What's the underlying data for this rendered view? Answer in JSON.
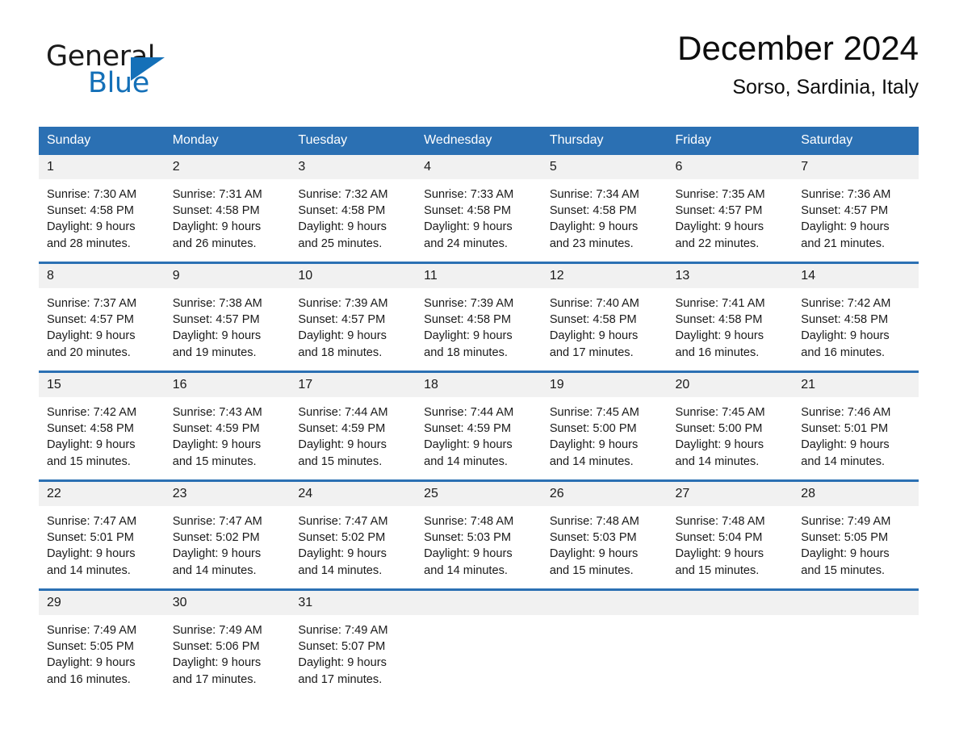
{
  "branding": {
    "logo_primary": "General",
    "logo_secondary": "Blue",
    "logo_triangle_color": "#1470b8"
  },
  "header": {
    "title": "December 2024",
    "subtitle": "Sorso, Sardinia, Italy"
  },
  "colors": {
    "header_blue": "#2b70b3",
    "row_divider_blue": "#2b70b3",
    "daynum_band": "#f1f1f1",
    "text": "#1a1a1a"
  },
  "weekday_headers": [
    "Sunday",
    "Monday",
    "Tuesday",
    "Wednesday",
    "Thursday",
    "Friday",
    "Saturday"
  ],
  "labels": {
    "sunrise_prefix": "Sunrise:",
    "sunset_prefix": "Sunset:",
    "daylight_prefix": "Daylight:"
  },
  "weeks": [
    [
      {
        "day": "1",
        "sunrise": "Sunrise: 7:30 AM",
        "sunset": "Sunset: 4:58 PM",
        "daylight_line1": "Daylight: 9 hours",
        "daylight_line2": "and 28 minutes."
      },
      {
        "day": "2",
        "sunrise": "Sunrise: 7:31 AM",
        "sunset": "Sunset: 4:58 PM",
        "daylight_line1": "Daylight: 9 hours",
        "daylight_line2": "and 26 minutes."
      },
      {
        "day": "3",
        "sunrise": "Sunrise: 7:32 AM",
        "sunset": "Sunset: 4:58 PM",
        "daylight_line1": "Daylight: 9 hours",
        "daylight_line2": "and 25 minutes."
      },
      {
        "day": "4",
        "sunrise": "Sunrise: 7:33 AM",
        "sunset": "Sunset: 4:58 PM",
        "daylight_line1": "Daylight: 9 hours",
        "daylight_line2": "and 24 minutes."
      },
      {
        "day": "5",
        "sunrise": "Sunrise: 7:34 AM",
        "sunset": "Sunset: 4:58 PM",
        "daylight_line1": "Daylight: 9 hours",
        "daylight_line2": "and 23 minutes."
      },
      {
        "day": "6",
        "sunrise": "Sunrise: 7:35 AM",
        "sunset": "Sunset: 4:57 PM",
        "daylight_line1": "Daylight: 9 hours",
        "daylight_line2": "and 22 minutes."
      },
      {
        "day": "7",
        "sunrise": "Sunrise: 7:36 AM",
        "sunset": "Sunset: 4:57 PM",
        "daylight_line1": "Daylight: 9 hours",
        "daylight_line2": "and 21 minutes."
      }
    ],
    [
      {
        "day": "8",
        "sunrise": "Sunrise: 7:37 AM",
        "sunset": "Sunset: 4:57 PM",
        "daylight_line1": "Daylight: 9 hours",
        "daylight_line2": "and 20 minutes."
      },
      {
        "day": "9",
        "sunrise": "Sunrise: 7:38 AM",
        "sunset": "Sunset: 4:57 PM",
        "daylight_line1": "Daylight: 9 hours",
        "daylight_line2": "and 19 minutes."
      },
      {
        "day": "10",
        "sunrise": "Sunrise: 7:39 AM",
        "sunset": "Sunset: 4:57 PM",
        "daylight_line1": "Daylight: 9 hours",
        "daylight_line2": "and 18 minutes."
      },
      {
        "day": "11",
        "sunrise": "Sunrise: 7:39 AM",
        "sunset": "Sunset: 4:58 PM",
        "daylight_line1": "Daylight: 9 hours",
        "daylight_line2": "and 18 minutes."
      },
      {
        "day": "12",
        "sunrise": "Sunrise: 7:40 AM",
        "sunset": "Sunset: 4:58 PM",
        "daylight_line1": "Daylight: 9 hours",
        "daylight_line2": "and 17 minutes."
      },
      {
        "day": "13",
        "sunrise": "Sunrise: 7:41 AM",
        "sunset": "Sunset: 4:58 PM",
        "daylight_line1": "Daylight: 9 hours",
        "daylight_line2": "and 16 minutes."
      },
      {
        "day": "14",
        "sunrise": "Sunrise: 7:42 AM",
        "sunset": "Sunset: 4:58 PM",
        "daylight_line1": "Daylight: 9 hours",
        "daylight_line2": "and 16 minutes."
      }
    ],
    [
      {
        "day": "15",
        "sunrise": "Sunrise: 7:42 AM",
        "sunset": "Sunset: 4:58 PM",
        "daylight_line1": "Daylight: 9 hours",
        "daylight_line2": "and 15 minutes."
      },
      {
        "day": "16",
        "sunrise": "Sunrise: 7:43 AM",
        "sunset": "Sunset: 4:59 PM",
        "daylight_line1": "Daylight: 9 hours",
        "daylight_line2": "and 15 minutes."
      },
      {
        "day": "17",
        "sunrise": "Sunrise: 7:44 AM",
        "sunset": "Sunset: 4:59 PM",
        "daylight_line1": "Daylight: 9 hours",
        "daylight_line2": "and 15 minutes."
      },
      {
        "day": "18",
        "sunrise": "Sunrise: 7:44 AM",
        "sunset": "Sunset: 4:59 PM",
        "daylight_line1": "Daylight: 9 hours",
        "daylight_line2": "and 14 minutes."
      },
      {
        "day": "19",
        "sunrise": "Sunrise: 7:45 AM",
        "sunset": "Sunset: 5:00 PM",
        "daylight_line1": "Daylight: 9 hours",
        "daylight_line2": "and 14 minutes."
      },
      {
        "day": "20",
        "sunrise": "Sunrise: 7:45 AM",
        "sunset": "Sunset: 5:00 PM",
        "daylight_line1": "Daylight: 9 hours",
        "daylight_line2": "and 14 minutes."
      },
      {
        "day": "21",
        "sunrise": "Sunrise: 7:46 AM",
        "sunset": "Sunset: 5:01 PM",
        "daylight_line1": "Daylight: 9 hours",
        "daylight_line2": "and 14 minutes."
      }
    ],
    [
      {
        "day": "22",
        "sunrise": "Sunrise: 7:47 AM",
        "sunset": "Sunset: 5:01 PM",
        "daylight_line1": "Daylight: 9 hours",
        "daylight_line2": "and 14 minutes."
      },
      {
        "day": "23",
        "sunrise": "Sunrise: 7:47 AM",
        "sunset": "Sunset: 5:02 PM",
        "daylight_line1": "Daylight: 9 hours",
        "daylight_line2": "and 14 minutes."
      },
      {
        "day": "24",
        "sunrise": "Sunrise: 7:47 AM",
        "sunset": "Sunset: 5:02 PM",
        "daylight_line1": "Daylight: 9 hours",
        "daylight_line2": "and 14 minutes."
      },
      {
        "day": "25",
        "sunrise": "Sunrise: 7:48 AM",
        "sunset": "Sunset: 5:03 PM",
        "daylight_line1": "Daylight: 9 hours",
        "daylight_line2": "and 14 minutes."
      },
      {
        "day": "26",
        "sunrise": "Sunrise: 7:48 AM",
        "sunset": "Sunset: 5:03 PM",
        "daylight_line1": "Daylight: 9 hours",
        "daylight_line2": "and 15 minutes."
      },
      {
        "day": "27",
        "sunrise": "Sunrise: 7:48 AM",
        "sunset": "Sunset: 5:04 PM",
        "daylight_line1": "Daylight: 9 hours",
        "daylight_line2": "and 15 minutes."
      },
      {
        "day": "28",
        "sunrise": "Sunrise: 7:49 AM",
        "sunset": "Sunset: 5:05 PM",
        "daylight_line1": "Daylight: 9 hours",
        "daylight_line2": "and 15 minutes."
      }
    ],
    [
      {
        "day": "29",
        "sunrise": "Sunrise: 7:49 AM",
        "sunset": "Sunset: 5:05 PM",
        "daylight_line1": "Daylight: 9 hours",
        "daylight_line2": "and 16 minutes."
      },
      {
        "day": "30",
        "sunrise": "Sunrise: 7:49 AM",
        "sunset": "Sunset: 5:06 PM",
        "daylight_line1": "Daylight: 9 hours",
        "daylight_line2": "and 17 minutes."
      },
      {
        "day": "31",
        "sunrise": "Sunrise: 7:49 AM",
        "sunset": "Sunset: 5:07 PM",
        "daylight_line1": "Daylight: 9 hours",
        "daylight_line2": "and 17 minutes."
      },
      {
        "day": "",
        "sunrise": "",
        "sunset": "",
        "daylight_line1": "",
        "daylight_line2": ""
      },
      {
        "day": "",
        "sunrise": "",
        "sunset": "",
        "daylight_line1": "",
        "daylight_line2": ""
      },
      {
        "day": "",
        "sunrise": "",
        "sunset": "",
        "daylight_line1": "",
        "daylight_line2": ""
      },
      {
        "day": "",
        "sunrise": "",
        "sunset": "",
        "daylight_line1": "",
        "daylight_line2": ""
      }
    ]
  ]
}
